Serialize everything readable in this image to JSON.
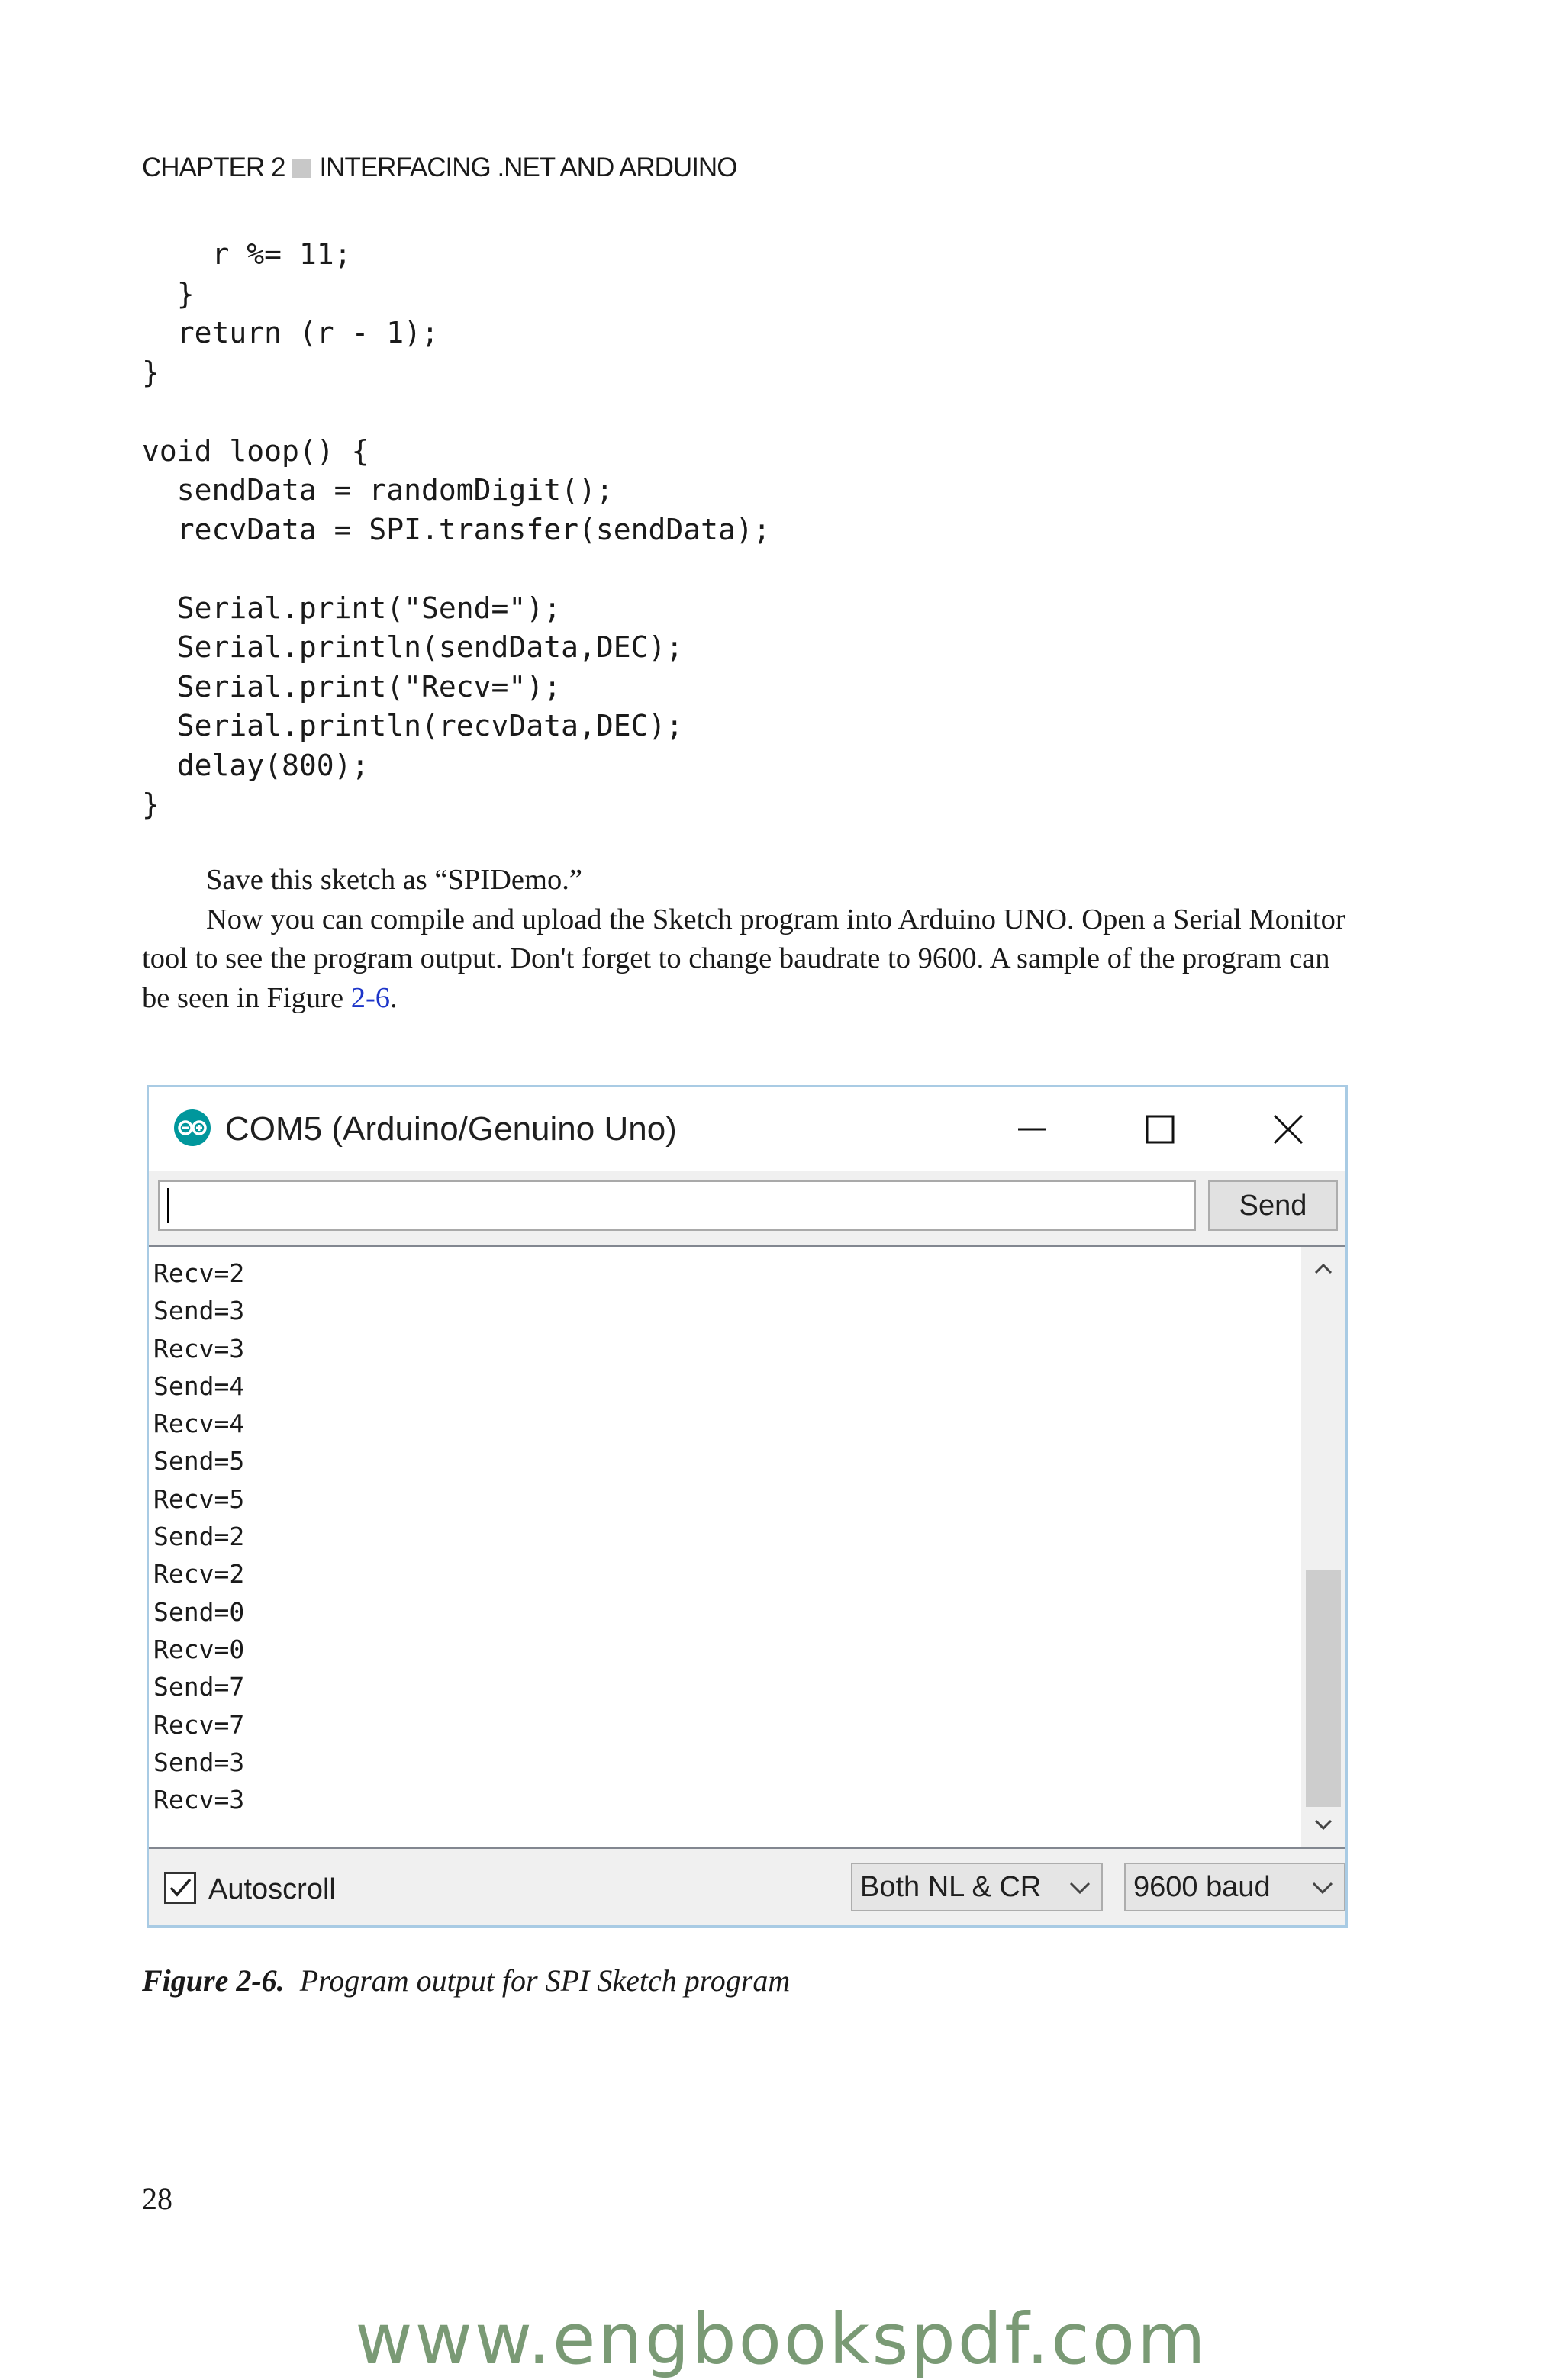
{
  "header": {
    "chapter": "CHAPTER 2",
    "title": "INTERFACING .NET AND ARDUINO"
  },
  "code_lines": [
    "    r %= 11;",
    "  }",
    "  return (r - 1);",
    "}",
    "",
    "void loop() {",
    "  sendData = randomDigit();",
    "  recvData = SPI.transfer(sendData);",
    "",
    "  Serial.print(\"Send=\");",
    "  Serial.println(sendData,DEC);",
    "  Serial.print(\"Recv=\");",
    "  Serial.println(recvData,DEC);",
    "  delay(800);",
    "}"
  ],
  "prose": {
    "p1": "Save this sketch as “SPIDemo.”",
    "p2_before": "Now you can compile and upload the Sketch program into Arduino UNO. Open a Serial Monitor tool to see the program output. Don't forget to change baudrate to 9600. A sample of the program can be seen in Figure ",
    "p2_link": "2-6",
    "p2_after": "."
  },
  "serial_monitor": {
    "title": "COM5 (Arduino/Genuino Uno)",
    "input_value": "",
    "send_label": "Send",
    "output_lines": [
      "Recv=2",
      "Send=3",
      "Recv=3",
      "Send=4",
      "Recv=4",
      "Send=5",
      "Recv=5",
      "Send=2",
      "Recv=2",
      "Send=0",
      "Recv=0",
      "Send=7",
      "Recv=7",
      "Send=3",
      "Recv=3"
    ],
    "autoscroll_label": "Autoscroll",
    "autoscroll_checked": true,
    "line_ending": "Both NL & CR",
    "baud": "9600 baud",
    "icons": {
      "app": "arduino-logo-icon",
      "minimize": "minimize-icon",
      "maximize": "maximize-icon",
      "close": "close-icon"
    },
    "colors": {
      "window_border": "#a9cbe4",
      "arduino_teal": "#00979c"
    }
  },
  "caption": {
    "label": "Figure 2-6.",
    "text": "Program output for SPI Sketch program"
  },
  "page_number": "28",
  "watermark": "www.engbookspdf.com"
}
